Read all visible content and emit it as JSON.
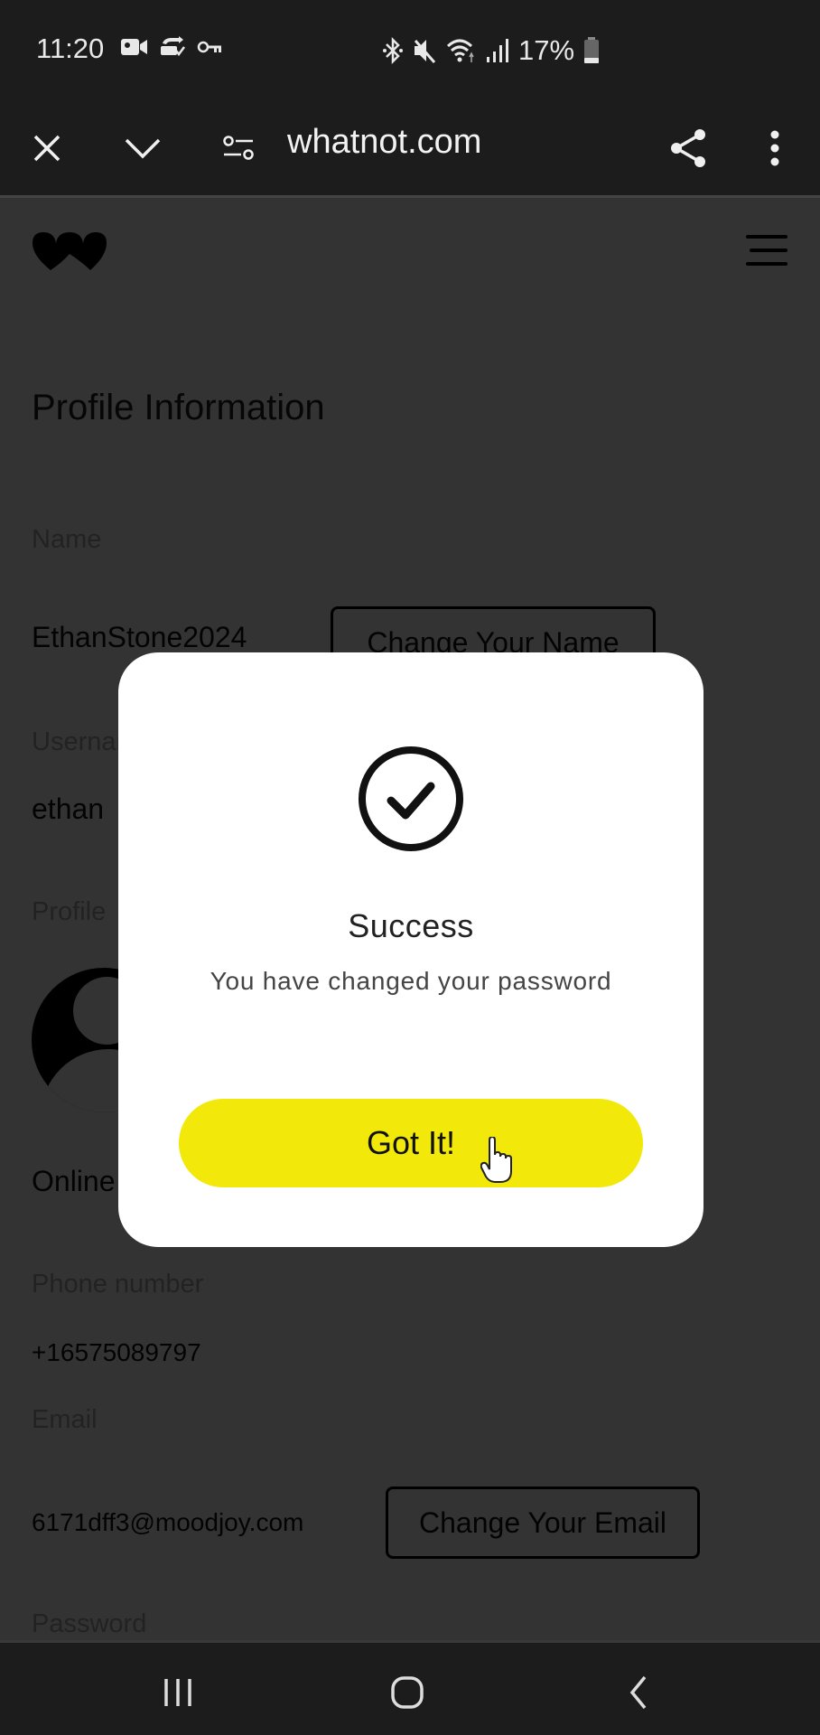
{
  "status_bar": {
    "time": "11:20",
    "left_icons": [
      "video-camera-icon",
      "sync-check-icon",
      "key-icon"
    ],
    "right_icons": [
      "bluetooth-icon",
      "mute-icon",
      "wifi-icon",
      "signal-icon"
    ],
    "battery_percent_label": "17%",
    "battery_level": 0.17
  },
  "browser": {
    "url": "whatnot.com",
    "close_icon": "close-icon",
    "dropdown_icon": "chevron-down-icon",
    "site_settings_icon": "site-settings-icon",
    "share_icon": "share-icon",
    "more_icon": "more-vertical-icon"
  },
  "page": {
    "heading": "Profile Information",
    "fields": {
      "name_label": "Name",
      "name_value": "EthanStone2024",
      "change_name_button": "Change Your Name",
      "username_label": "Username",
      "username_value": "ethan",
      "profile_label": "Profile",
      "online_label": "Online",
      "phone_label": "Phone number",
      "phone_value": "+16575089797",
      "email_label": "Email",
      "email_value": "6171dff3@moodjoy.com",
      "change_email_button": "Change Your Email",
      "password_label": "Password"
    }
  },
  "modal": {
    "icon": "check-circle-icon",
    "title": "Success",
    "message": "You have changed your password",
    "button_label": "Got It!",
    "button_color": "#f2e809"
  },
  "nav_bar": {
    "recents": "recents-icon",
    "home": "home-icon",
    "back": "back-icon"
  }
}
